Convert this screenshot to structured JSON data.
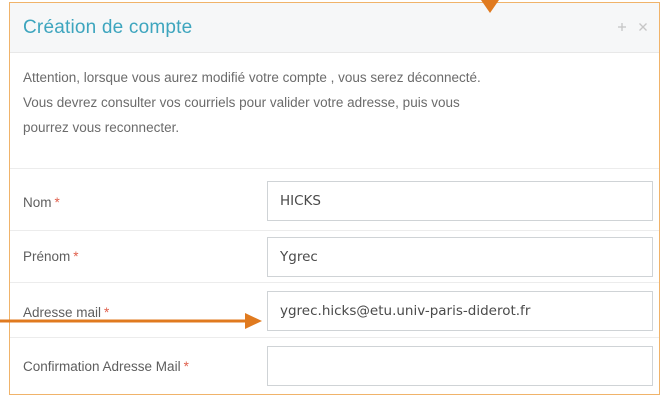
{
  "panel": {
    "title": "Création de compte",
    "plus_icon": "plus-icon",
    "close_icon": "close-icon"
  },
  "notice": {
    "line1": "Attention, lorsque vous aurez modifié votre compte , vous serez déconnecté.",
    "line2": "Vous devrez consulter vos courriels pour valider votre adresse, puis vous",
    "line3": "pourrez vous reconnecter."
  },
  "form": {
    "required_marker": "*",
    "fields": [
      {
        "label": "Nom",
        "value": "HICKS"
      },
      {
        "label": "Prénom",
        "value": "Ygrec"
      },
      {
        "label": "Adresse mail",
        "value": "ygrec.hicks@etu.univ-paris-diderot.fr"
      },
      {
        "label": "Confirmation Adresse Mail",
        "value": ""
      }
    ]
  },
  "colors": {
    "title": "#3da5be",
    "required": "#e0604d",
    "annotation_arrow": "#e07a1f",
    "panel_border": "#f0b36a"
  }
}
